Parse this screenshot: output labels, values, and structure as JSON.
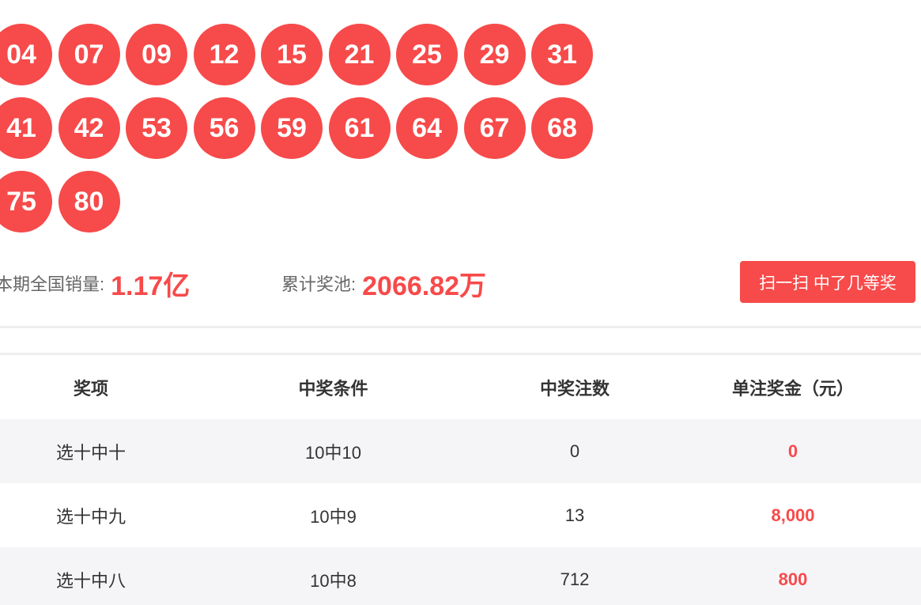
{
  "draw_numbers": [
    [
      "04",
      "07",
      "09",
      "12",
      "15",
      "21",
      "25",
      "29",
      "31"
    ],
    [
      "41",
      "42",
      "53",
      "56",
      "59",
      "61",
      "64",
      "67",
      "68"
    ],
    [
      "75",
      "80"
    ]
  ],
  "summary": {
    "sales_label": "本期全国销量:",
    "sales_value": "1.17亿",
    "pool_label": "累计奖池:",
    "pool_value": "2066.82万",
    "scan_button_label": "扫一扫 中了几等奖"
  },
  "prize_table": {
    "headers": [
      "奖项",
      "中奖条件",
      "中奖注数",
      "单注奖金（元）"
    ],
    "rows": [
      {
        "level": "选十中十",
        "condition": "10中10",
        "count": "0",
        "amount": "0"
      },
      {
        "level": "选十中九",
        "condition": "10中9",
        "count": "13",
        "amount": "8,000"
      },
      {
        "level": "选十中八",
        "condition": "10中8",
        "count": "712",
        "amount": "800"
      }
    ]
  },
  "colors": {
    "accent": "#f74a4a",
    "row_alt_bg": "#f5f5f8",
    "text": "#333333",
    "muted_text": "#666666"
  }
}
